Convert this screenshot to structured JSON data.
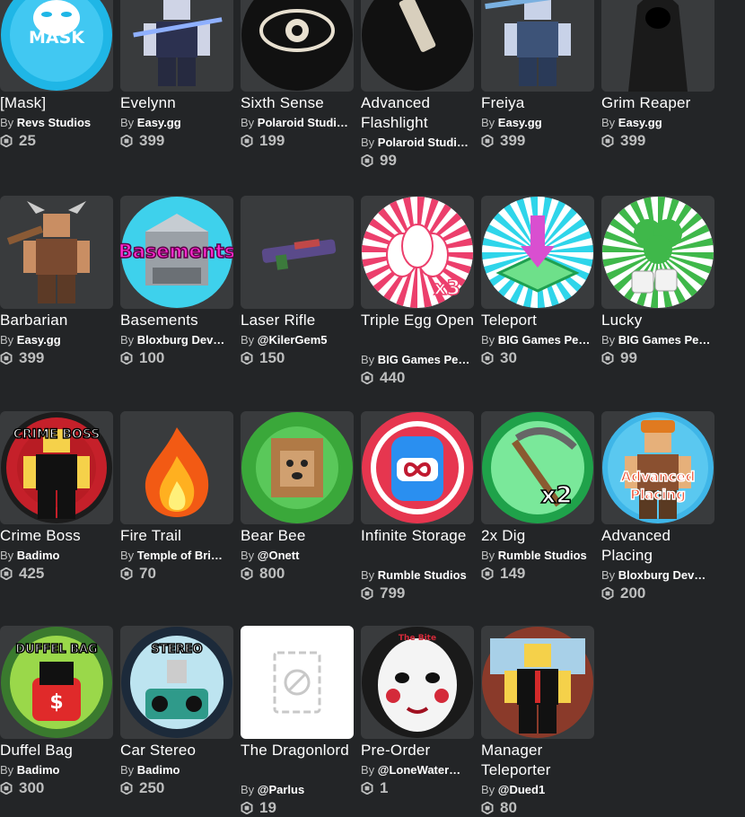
{
  "currency_icon": "robux-icon",
  "items": [
    {
      "name": "[Mask]",
      "by": "By",
      "creator": "Revs Studios",
      "price": "25",
      "icon": "anonymous-mask-icon",
      "thumb_label": "MASK"
    },
    {
      "name": "Evelynn",
      "by": "By",
      "creator": "Easy.gg",
      "price": "399",
      "icon": "armored-knight-avatar-icon"
    },
    {
      "name": "Sixth Sense",
      "by": "By",
      "creator": "Polaroid Studi…",
      "price": "199",
      "icon": "eye-icon"
    },
    {
      "name": "Advanced Flashlight",
      "by": "By",
      "creator": "Polaroid Studi…",
      "price": "99",
      "icon": "flashlight-icon"
    },
    {
      "name": "Freiya",
      "by": "By",
      "creator": "Easy.gg",
      "price": "399",
      "icon": "ice-warrior-avatar-icon"
    },
    {
      "name": "Grim Reaper",
      "by": "By",
      "creator": "Easy.gg",
      "price": "399",
      "icon": "grim-reaper-avatar-icon"
    },
    {
      "name": "Barbarian",
      "by": "By",
      "creator": "Easy.gg",
      "price": "399",
      "icon": "barbarian-avatar-icon"
    },
    {
      "name": "Basements",
      "by": "By",
      "creator": "Bloxburg Dev…",
      "price": "100",
      "icon": "basement-room-icon",
      "thumb_label": "Basements"
    },
    {
      "name": "Laser Rifle",
      "by": "By",
      "creator": "@KilerGem5",
      "price": "150",
      "icon": "laser-rifle-icon"
    },
    {
      "name": "Triple Egg Open",
      "by": "By",
      "creator": "BIG Games Pe…",
      "price": "440",
      "icon": "eggs-icon",
      "thumb_label": "x3"
    },
    {
      "name": "Teleport",
      "by": "By",
      "creator": "BIG Games Pe…",
      "price": "30",
      "icon": "teleport-arrow-icon"
    },
    {
      "name": "Lucky",
      "by": "By",
      "creator": "BIG Games Pe…",
      "price": "99",
      "icon": "clover-dice-icon"
    },
    {
      "name": "Crime Boss",
      "by": "By",
      "creator": "Badimo",
      "price": "425",
      "icon": "crime-boss-badge-icon",
      "thumb_label": "CRIME BOSS"
    },
    {
      "name": "Fire Trail",
      "by": "By",
      "creator": "Temple of Bri…",
      "price": "70",
      "icon": "fire-icon"
    },
    {
      "name": "Bear Bee",
      "by": "By",
      "creator": "@Onett",
      "price": "800",
      "icon": "bear-bee-icon"
    },
    {
      "name": "Infinite Storage",
      "by": "By",
      "creator": "Rumble Studios",
      "price": "799",
      "icon": "infinite-backpack-icon"
    },
    {
      "name": "2x Dig",
      "by": "By",
      "creator": "Rumble Studios",
      "price": "149",
      "icon": "pickaxe-icon",
      "thumb_label": "x2"
    },
    {
      "name": "Advanced Placing",
      "by": "By",
      "creator": "Bloxburg Dev…",
      "price": "200",
      "icon": "builder-avatar-icon",
      "thumb_label": "Advanced Placing"
    },
    {
      "name": "Duffel Bag",
      "by": "By",
      "creator": "Badimo",
      "price": "300",
      "icon": "duffel-bag-icon",
      "thumb_label": "DUFFEL BAG"
    },
    {
      "name": "Car Stereo",
      "by": "By",
      "creator": "Badimo",
      "price": "250",
      "icon": "car-stereo-icon",
      "thumb_label": "STEREO"
    },
    {
      "name": "The Dragonlord",
      "by": "By",
      "creator": "@Parlus",
      "price": "19",
      "icon": "image-unavailable-icon"
    },
    {
      "name": "Pre-Order",
      "by": "By",
      "creator": "@LoneWater…",
      "price": "1",
      "icon": "puppet-mask-icon",
      "thumb_label": "The Bite"
    },
    {
      "name": "Manager Teleporter",
      "by": "By",
      "creator": "@Dued1",
      "price": "80",
      "icon": "manager-avatar-icon"
    }
  ]
}
